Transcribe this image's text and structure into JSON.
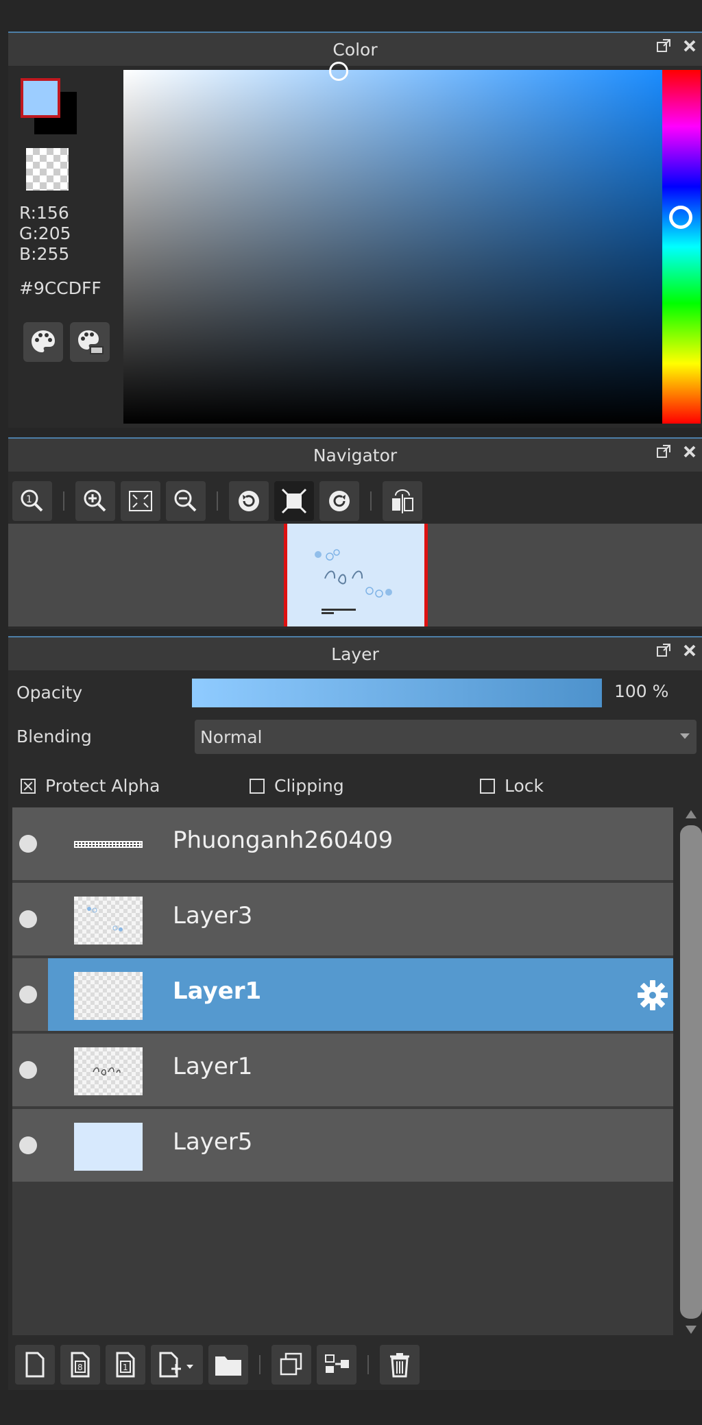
{
  "color_panel": {
    "title": "Color",
    "foreground_hex": "#9CCDFF",
    "r_label": "R:156",
    "g_label": "G:205",
    "b_label": "B:255",
    "hex_label": "#9CCDFF",
    "buttons": [
      "palette-icon",
      "palette-edit-icon"
    ]
  },
  "navigator_panel": {
    "title": "Navigator",
    "tools": [
      "zoom-actual-icon",
      "zoom-in-icon",
      "fit-screen-icon",
      "zoom-out-icon",
      "rotate-left-icon",
      "fit-window-icon",
      "rotate-right-icon",
      "flip-horizontal-icon"
    ]
  },
  "layer_panel": {
    "title": "Layer",
    "opacity_label": "Opacity",
    "opacity_value": "100 %",
    "opacity_fraction": 1.0,
    "blending_label": "Blending",
    "blending_value": "Normal",
    "protect_alpha_label": "Protect Alpha",
    "protect_alpha_checked": true,
    "clipping_label": "Clipping",
    "clipping_checked": false,
    "lock_label": "Lock",
    "lock_checked": false,
    "layers": [
      {
        "name": "Phuonganh260409",
        "selected": false
      },
      {
        "name": "Layer3",
        "selected": false
      },
      {
        "name": "Layer1",
        "selected": true
      },
      {
        "name": "Layer1",
        "selected": false
      },
      {
        "name": "Layer5",
        "selected": false
      }
    ],
    "toolbar": [
      "new-layer-icon",
      "new-8bit-layer-icon",
      "new-1bit-layer-icon",
      "add-layer-menu-icon",
      "folder-icon",
      "duplicate-layer-icon",
      "merge-layer-icon",
      "delete-layer-icon"
    ]
  }
}
